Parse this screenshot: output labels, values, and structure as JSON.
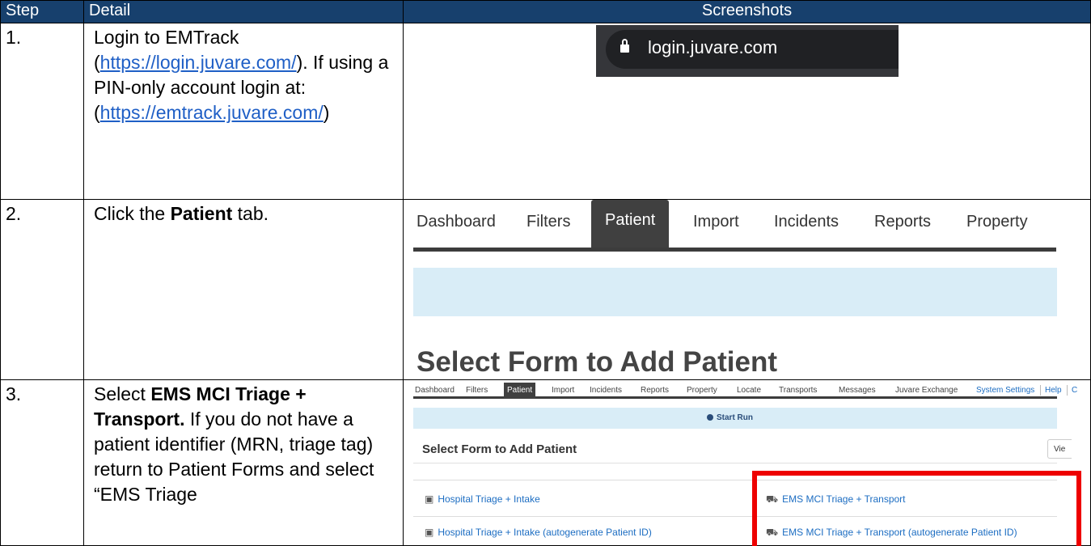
{
  "headers": {
    "step": "Step",
    "detail": "Detail",
    "screenshots": "Screenshots"
  },
  "rows": [
    {
      "step": "1.",
      "login_text": "Login to EMTrack (",
      "login_link": "https://login.juvare.com/",
      "login_close": ").",
      "pin_text": " If using a PIN-only account login at: (",
      "pin_link": "https://emtrack.juvare.com/",
      "pin_close": ")",
      "address_bar": "login.juvare.com"
    },
    {
      "step": "2.",
      "prefix": "Click the ",
      "bold": "Patient",
      "suffix": " tab.",
      "tabs": [
        "Dashboard",
        "Filters",
        "Patient",
        "Import",
        "Incidents",
        "Reports",
        "Property"
      ],
      "title": "Select Form to Add Patient"
    },
    {
      "step": "3.",
      "prefix": "Select ",
      "bold": "EMS MCI Triage + Transport.",
      "suffix": " If you do not have a patient identifier (MRN, triage tag) return to Patient Forms and select “EMS Triage",
      "nav": [
        "Dashboard",
        "Filters",
        "Patient",
        "Import",
        "Incidents",
        "Reports",
        "Property",
        "Locate",
        "Transports",
        "Messages",
        "Juvare Exchange",
        "System Settings",
        "Help",
        "C"
      ],
      "start_run": "Start Run",
      "heading": "Select Form to Add Patient",
      "view_button": "Vie",
      "forms": [
        "Hospital Triage + Intake",
        "EMS MCI Triage + Transport",
        "Hospital Triage + Intake (autogenerate Patient ID)",
        "EMS MCI Triage + Transport (autogenerate Patient ID)"
      ]
    }
  ],
  "colors": {
    "header_bg": "#17406d",
    "link": "#1f5fc6",
    "highlight": "#ee0000",
    "info_band": "#d9edf7"
  }
}
